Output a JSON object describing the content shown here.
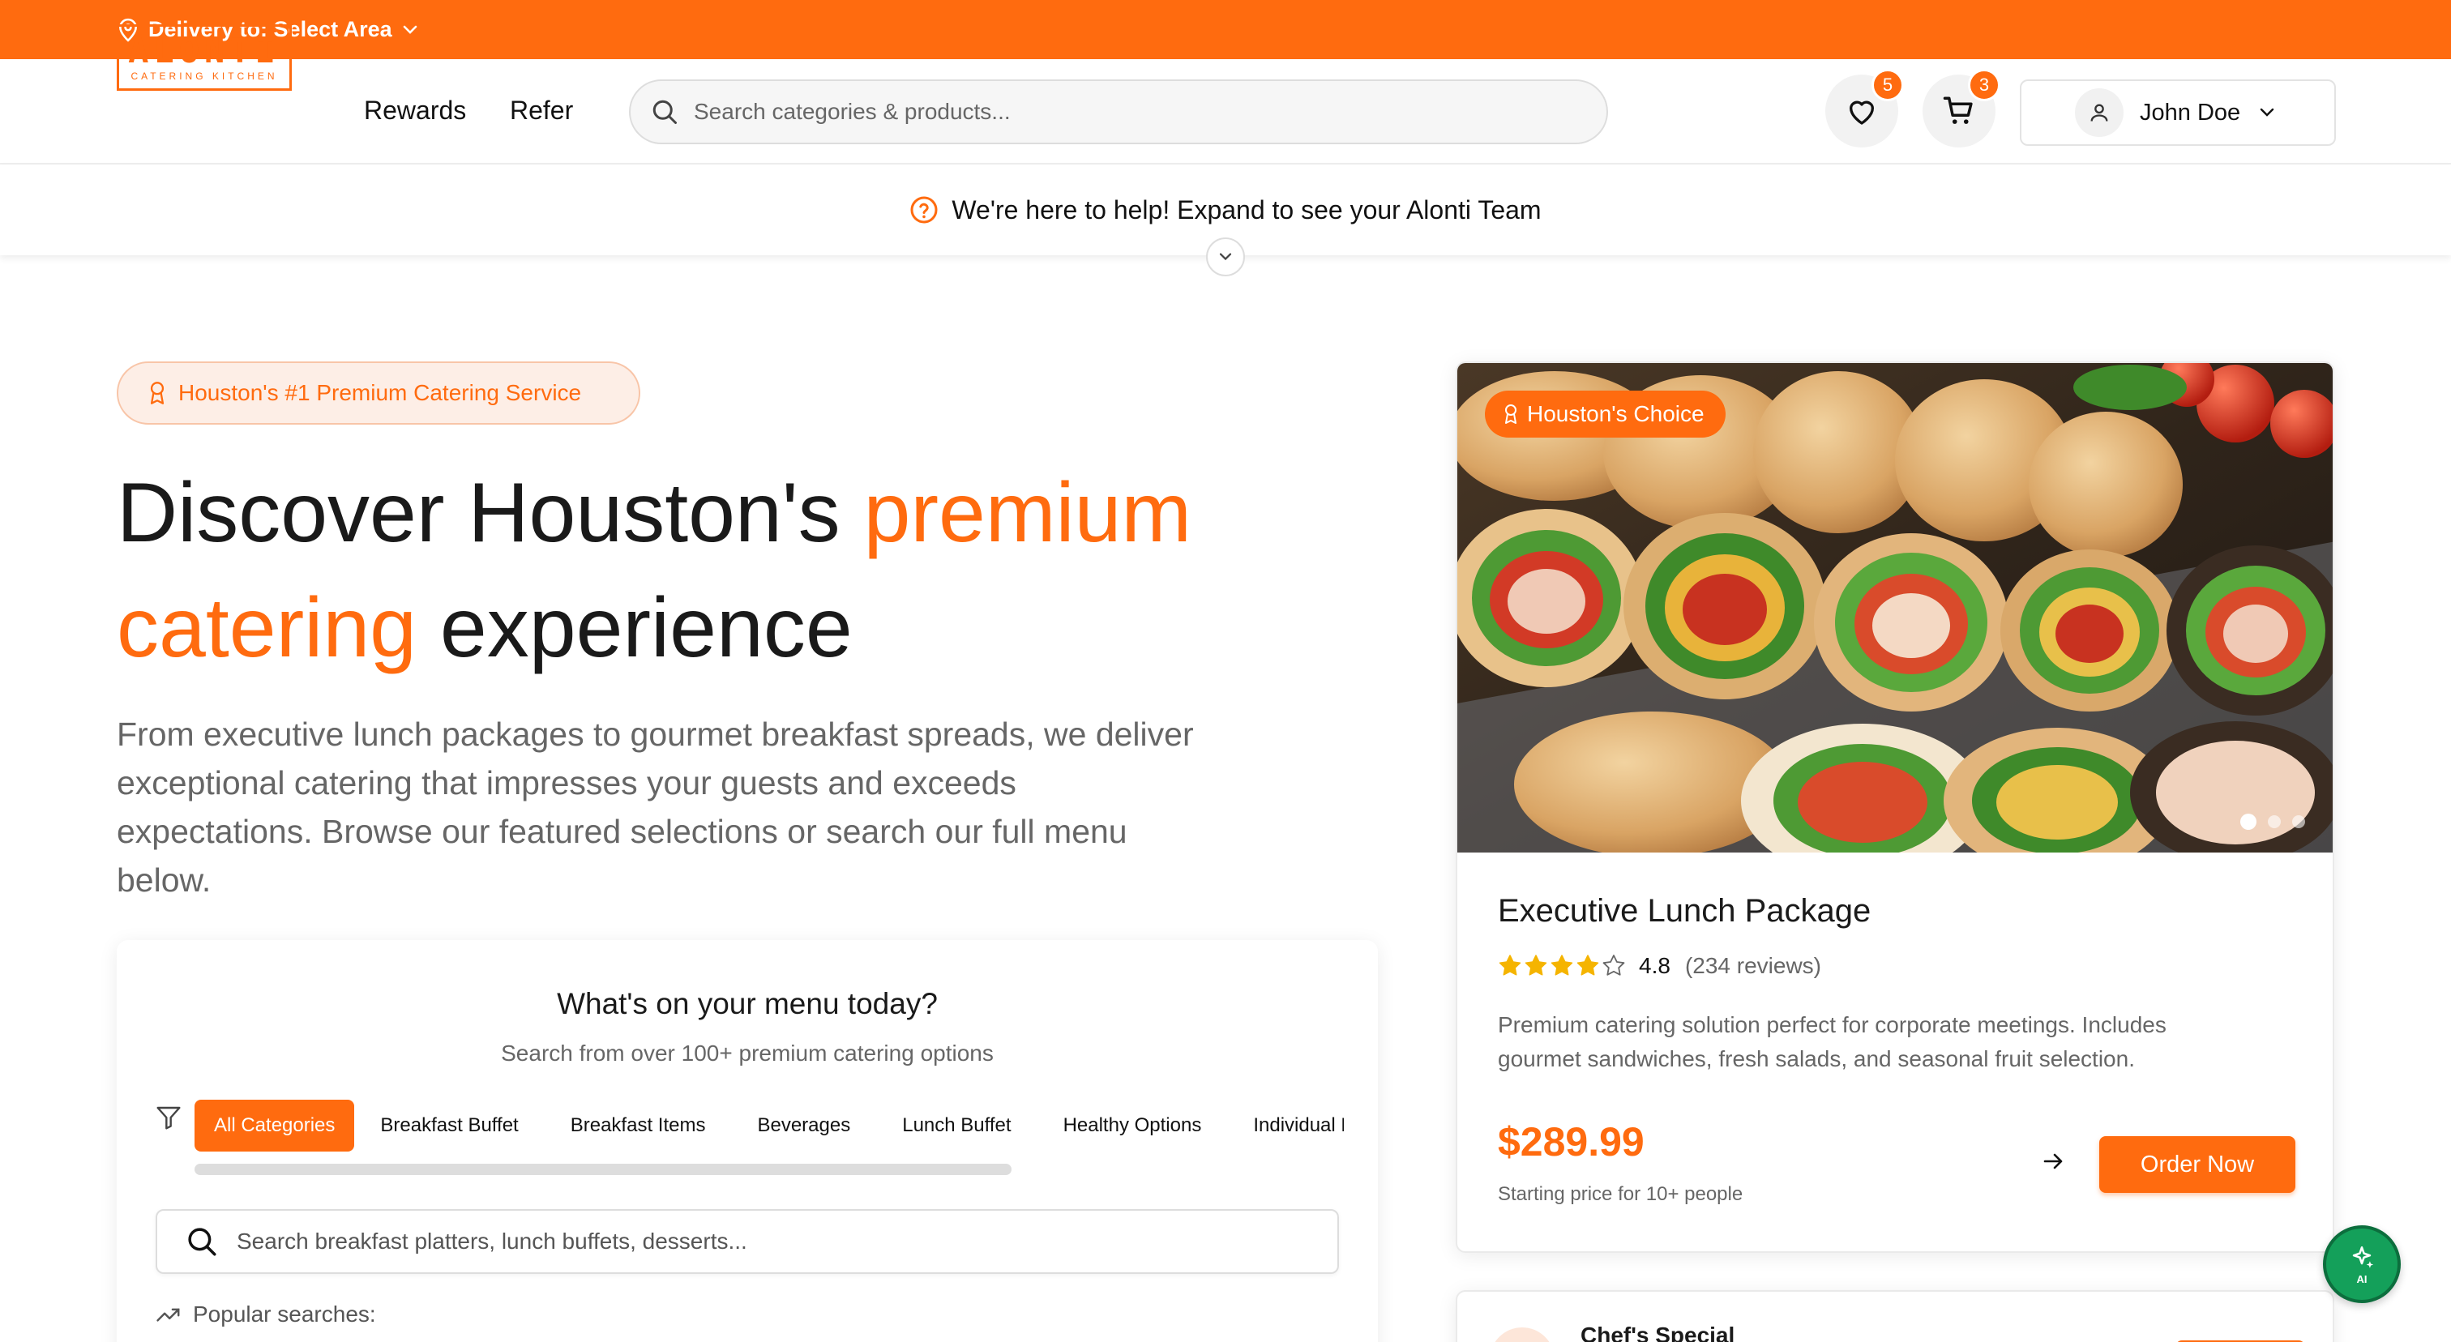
{
  "topbar": {
    "delivery_label": "Delivery to: Select Area"
  },
  "header": {
    "logo_main": "ALONTI",
    "logo_sub": "CATERING KITCHEN",
    "nav": [
      "Rewards",
      "Refer"
    ],
    "search_placeholder": "Search categories & products...",
    "wishlist_count": "5",
    "cart_count": "3",
    "user_name": "John Doe"
  },
  "help_banner": {
    "text": "We're here to help! Expand to see your Alonti Team"
  },
  "hero": {
    "pill": "Houston's #1 Premium Catering Service",
    "title_part1": "Discover Houston's ",
    "title_highlight1": "premium",
    "title_highlight2": "catering",
    "title_part2": " experience",
    "lead": "From executive lunch packages to gourmet breakfast spreads, we deliver exceptional catering that impresses your guests and exceeds expectations. Browse our featured selections or search our full menu below."
  },
  "menu_search": {
    "title": "What's on your menu today?",
    "subtitle": "Search from over 100+ premium catering options",
    "categories": [
      "All Categories",
      "Breakfast Buffet",
      "Breakfast Items",
      "Beverages",
      "Lunch Buffet",
      "Healthy Options",
      "Individual Boxed Lunch"
    ],
    "active_category": "All Categories",
    "search_placeholder": "Search breakfast platters, lunch buffets, desserts...",
    "popular_label": "Popular searches:"
  },
  "featured": {
    "tag": "Houston's Choice",
    "title": "Executive Lunch Package",
    "rating": "4.8",
    "stars": 4,
    "reviews": "(234 reviews)",
    "description": "Premium catering solution perfect for corporate meetings. Includes gourmet sandwiches, fresh salads, and seasonal fruit selection.",
    "price": "$289.99",
    "price_note": "Starting price for 10+ people",
    "order_label": "Order Now",
    "slide_index": 1,
    "slide_count": 3
  },
  "next_card": {
    "title": "Chef's Special"
  },
  "ai_fab": {
    "label": "AI"
  },
  "colors": {
    "accent": "#ff6b0f",
    "text": "#1a1a1a",
    "muted": "#666666",
    "ai_green": "#14a05a"
  }
}
